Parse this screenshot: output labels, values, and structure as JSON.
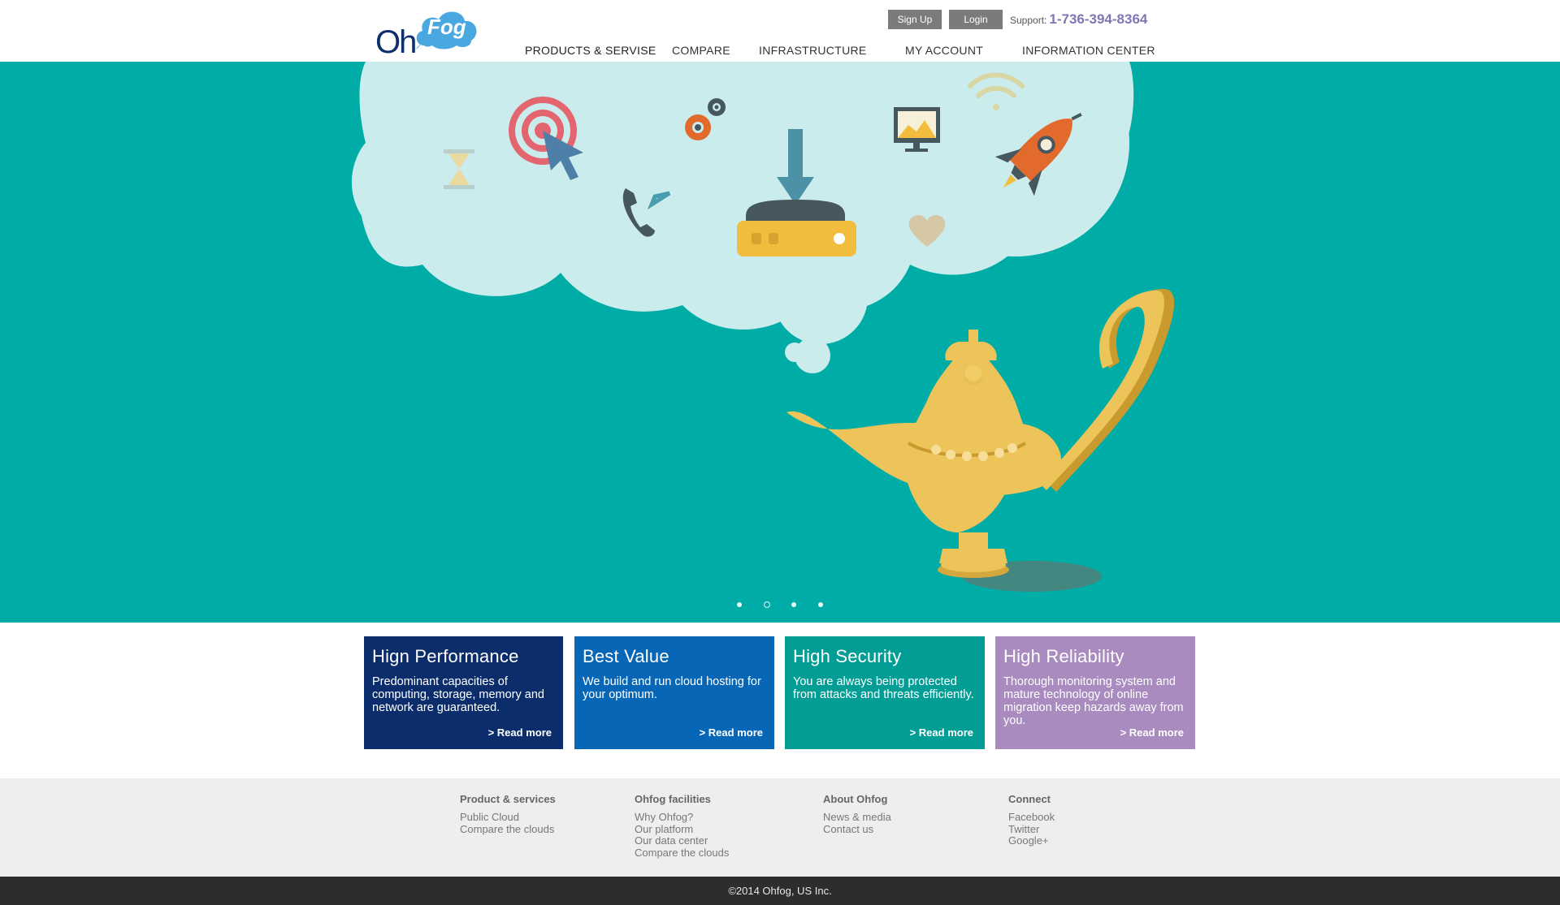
{
  "header": {
    "logo": {
      "part1": "Oh",
      "part2": "Fog"
    },
    "signup_label": "Sign Up",
    "login_label": "Login",
    "support_label": "Support:",
    "support_phone": "1-736-394-8364",
    "nav": [
      {
        "label": "PRODUCTS & SERVISE",
        "active": true
      },
      {
        "label": "COMPARE"
      },
      {
        "label": "INFRASTRUCTURE"
      },
      {
        "label": "MY ACCOUNT"
      },
      {
        "label": "INFORMATION CENTER"
      }
    ]
  },
  "hero": {
    "background": "#00ada6",
    "slides": 4,
    "active_slide": 2
  },
  "features": [
    {
      "title": "Hign Performance",
      "text": "Predominant capacities of computing, storage, memory and network are guaranteed.",
      "more": "> Read more",
      "color": "#0c2d6b"
    },
    {
      "title": "Best Value",
      "text": "We build and run cloud hosting for your optimum.",
      "more": "> Read more",
      "color": "#0767b6"
    },
    {
      "title": "High Security",
      "text": "You are always being protected from attacks and threats efficiently.",
      "more": "> Read more",
      "color": "#029e96"
    },
    {
      "title": "High Reliability",
      "text": "Thorough monitoring system and mature technology of online migration keep hazards away from you.",
      "more": "> Read more",
      "color": "#a98bbf"
    }
  ],
  "footer": {
    "columns": [
      {
        "heading": "Product & services",
        "links": [
          "Public Cloud",
          "Compare the clouds"
        ]
      },
      {
        "heading": "Ohfog facilities",
        "links": [
          "Why Ohfog?",
          "Our platform",
          "Our data center",
          "Compare the clouds"
        ]
      },
      {
        "heading": "About Ohfog",
        "links": [
          "News & media",
          "Contact us"
        ]
      },
      {
        "heading": "Connect",
        "links": [
          "Facebook",
          "Twitter",
          "Google+"
        ]
      }
    ],
    "copyright": "©2014 Ohfog, US Inc."
  }
}
